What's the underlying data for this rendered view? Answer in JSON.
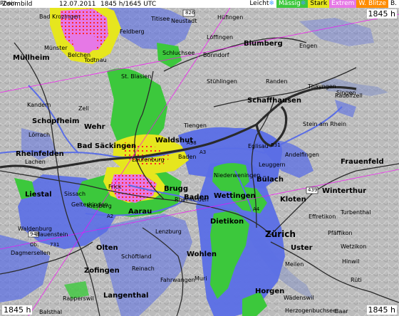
{
  "header": {
    "zoom_label": "Zoombild",
    "date": "12.07.2011",
    "time": "1845 h/1645 UTC"
  },
  "legend": [
    {
      "label": "Leicht",
      "icon": "snowflake-icon",
      "bg": "#ffffff",
      "fg": "#000000"
    },
    {
      "label": "Mässig",
      "icon": "snowflake-icon",
      "bg": "#3cc83c",
      "fg": "#ffffff"
    },
    {
      "label": "Stark",
      "icon": "",
      "bg": "#e6e61e",
      "fg": "#000000"
    },
    {
      "label": "Extrem",
      "icon": "",
      "bg": "#e678e6",
      "fg": "#ffffff"
    },
    {
      "label": "W. Blitze",
      "icon": "",
      "bg": "#ff8c00",
      "fg": "#ffffff"
    },
    {
      "label": "B.",
      "icon": "",
      "bg": "#ffffff",
      "fg": "#000000"
    }
  ],
  "corners": {
    "top_right": "1845 h",
    "bottom_left": "1845 h",
    "bottom_right": "1845 h"
  },
  "colors": {
    "leicht": "#5a6ee6",
    "leicht_light": "#8ca0f0",
    "maessig": "#3cc83c",
    "stark": "#e6e61e",
    "extrem": "#e678e6",
    "blitze": "#ff3232",
    "border": "#ff00ff"
  },
  "places": [
    {
      "name": "Bad Krozingen",
      "cls": ""
    },
    {
      "name": "Münster",
      "cls": ""
    },
    {
      "name": "Müllheim",
      "cls": "big"
    },
    {
      "name": "Belchen",
      "cls": ""
    },
    {
      "name": "Todtnau",
      "cls": ""
    },
    {
      "name": "Feldberg",
      "cls": ""
    },
    {
      "name": "Titisee",
      "cls": ""
    },
    {
      "name": "Neustadt",
      "cls": ""
    },
    {
      "name": "Löffingen",
      "cls": ""
    },
    {
      "name": "Hüfingen",
      "cls": ""
    },
    {
      "name": "Blumberg",
      "cls": "big"
    },
    {
      "name": "Schluchsee",
      "cls": ""
    },
    {
      "name": "Bonndorf",
      "cls": ""
    },
    {
      "name": "St. Blasien",
      "cls": ""
    },
    {
      "name": "Kandern",
      "cls": ""
    },
    {
      "name": "Schopfheim",
      "cls": "big"
    },
    {
      "name": "Zell",
      "cls": ""
    },
    {
      "name": "Wehr",
      "cls": "big"
    },
    {
      "name": "Lörrach",
      "cls": ""
    },
    {
      "name": "Stühlingen",
      "cls": ""
    },
    {
      "name": "Schaffhausen",
      "cls": "big"
    },
    {
      "name": "Thayngen",
      "cls": ""
    },
    {
      "name": "Radolfzell",
      "cls": ""
    },
    {
      "name": "Singen",
      "cls": ""
    },
    {
      "name": "Engen",
      "cls": ""
    },
    {
      "name": "Randen",
      "cls": ""
    },
    {
      "name": "Rheinfelden",
      "cls": "big"
    },
    {
      "name": "Bad Säckingen",
      "cls": "big"
    },
    {
      "name": "Laufenburg",
      "cls": ""
    },
    {
      "name": "Waldshut",
      "cls": "big"
    },
    {
      "name": "Tiengen",
      "cls": ""
    },
    {
      "name": "Stein am Rhein",
      "cls": ""
    },
    {
      "name": "Andelfingen",
      "cls": ""
    },
    {
      "name": "Frauenfeld",
      "cls": "big"
    },
    {
      "name": "Eglisau",
      "cls": ""
    },
    {
      "name": "Bülach",
      "cls": "big"
    },
    {
      "name": "Niederweningen",
      "cls": ""
    },
    {
      "name": "Winterthur",
      "cls": "big"
    },
    {
      "name": "Kloten",
      "cls": "big"
    },
    {
      "name": "Brugg",
      "cls": "big"
    },
    {
      "name": "Frick",
      "cls": ""
    },
    {
      "name": "Sissach",
      "cls": ""
    },
    {
      "name": "Liestal",
      "cls": "big"
    },
    {
      "name": "Gelterkinden",
      "cls": ""
    },
    {
      "name": "Baden",
      "cls": "big"
    },
    {
      "name": "Wettingen",
      "cls": "big"
    },
    {
      "name": "Kiesberg",
      "cls": ""
    },
    {
      "name": "Aarau",
      "cls": "big"
    },
    {
      "name": "Dietikon",
      "cls": "big"
    },
    {
      "name": "Zürich",
      "cls": "huge"
    },
    {
      "name": "Effretikon",
      "cls": ""
    },
    {
      "name": "Turbenthal",
      "cls": ""
    },
    {
      "name": "Pfäffikon",
      "cls": ""
    },
    {
      "name": "Uster",
      "cls": "big"
    },
    {
      "name": "Wetzikon",
      "cls": ""
    },
    {
      "name": "Hinwil",
      "cls": ""
    },
    {
      "name": "Waldenburg",
      "cls": ""
    },
    {
      "name": "Hauenstein",
      "cls": ""
    },
    {
      "name": "Lenzburg",
      "cls": ""
    },
    {
      "name": "Olten",
      "cls": "big"
    },
    {
      "name": "Schöftland",
      "cls": ""
    },
    {
      "name": "Wohlen",
      "cls": "big"
    },
    {
      "name": "Zofingen",
      "cls": "big"
    },
    {
      "name": "Reinach",
      "cls": ""
    },
    {
      "name": "Fahrwangen",
      "cls": ""
    },
    {
      "name": "Muri",
      "cls": ""
    },
    {
      "name": "Meilen",
      "cls": ""
    },
    {
      "name": "Horgen",
      "cls": "big"
    },
    {
      "name": "Wädenswil",
      "cls": ""
    },
    {
      "name": "Rüti",
      "cls": ""
    },
    {
      "name": "Rapperswil",
      "cls": ""
    },
    {
      "name": "Langenthal",
      "cls": "big"
    },
    {
      "name": "Dagmersellen",
      "cls": ""
    },
    {
      "name": "Balsthal",
      "cls": ""
    },
    {
      "name": "Herzogenbuchsee",
      "cls": ""
    },
    {
      "name": "Baar",
      "cls": ""
    },
    {
      "name": "Lachen",
      "cls": ""
    },
    {
      "name": "Rheinfelden",
      "cls": ""
    },
    {
      "name": "Baden",
      "cls": ""
    },
    {
      "name": "Leuggern",
      "cls": ""
    },
    {
      "name": "Rhein",
      "cls": ""
    }
  ],
  "roads": [
    "826",
    "A98",
    "A3",
    "439",
    "A2",
    "943",
    "B31",
    "Ob.",
    "731",
    "A4"
  ]
}
